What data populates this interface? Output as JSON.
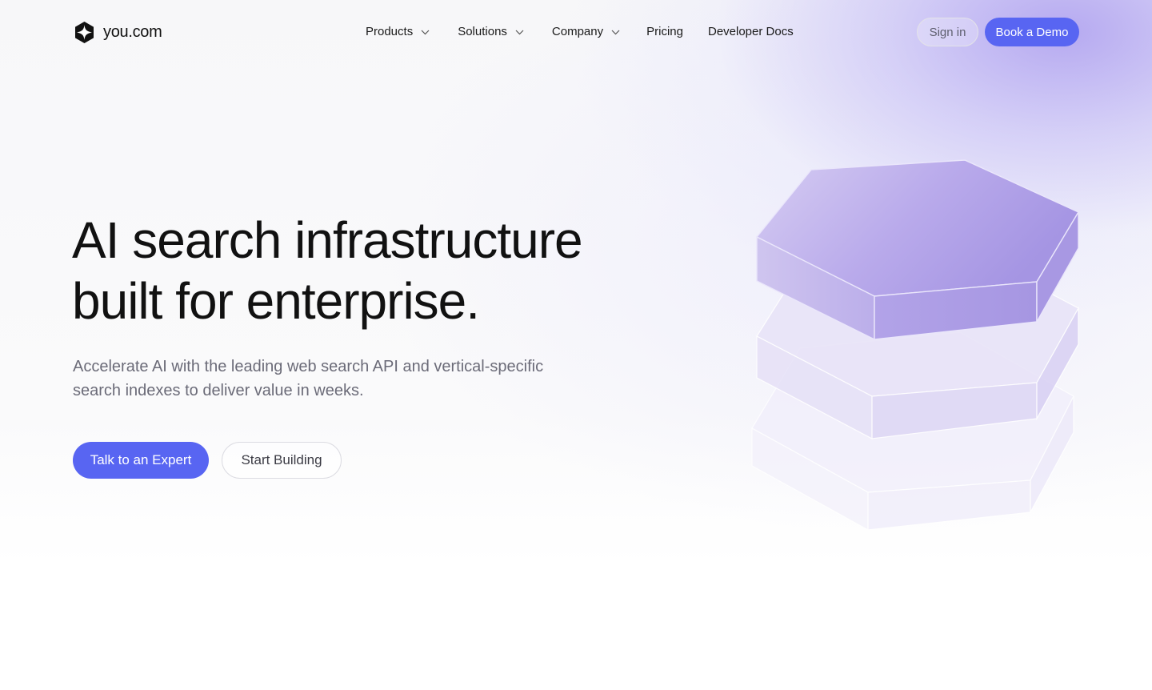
{
  "brand": {
    "name": "you.com"
  },
  "nav": {
    "items": [
      {
        "label": "Products",
        "dropdown": true
      },
      {
        "label": "Solutions",
        "dropdown": true
      },
      {
        "label": "Company",
        "dropdown": true
      },
      {
        "label": "Pricing",
        "dropdown": false
      },
      {
        "label": "Developer Docs",
        "dropdown": false
      }
    ]
  },
  "header": {
    "signin_label": "Sign in",
    "demo_label": "Book a Demo"
  },
  "hero": {
    "title_line1": "AI search infrastructure",
    "title_line2": "built for enterprise.",
    "subtitle_line1": "Accelerate AI with the leading web search API and vertical-specific",
    "subtitle_line2": "search indexes to deliver value in weeks.",
    "primary_cta": "Talk to an Expert",
    "secondary_cta": "Start Building"
  },
  "colors": {
    "accent": "#5865f2",
    "text": "#111111",
    "muted_text": "#6b6b78",
    "hex_purple": "#a99be6"
  },
  "icons": {
    "logo": "you-com-logo-icon",
    "dropdown": "chevron-down-icon",
    "hero_art": "stacked-hexagons-illustration"
  }
}
